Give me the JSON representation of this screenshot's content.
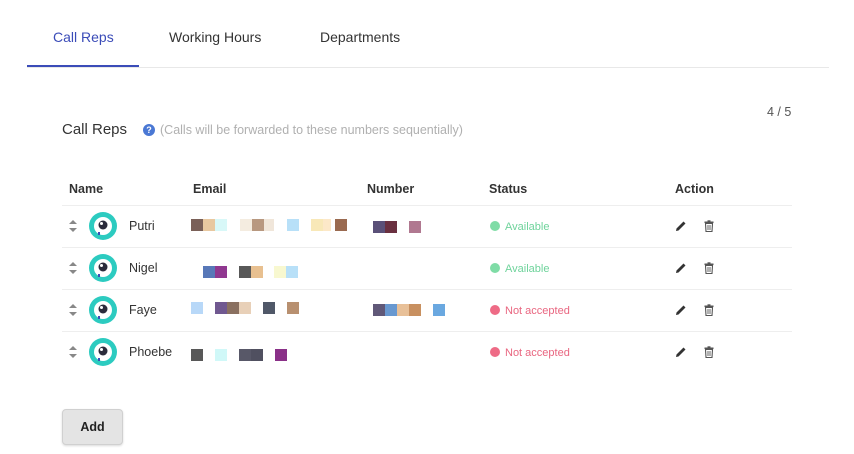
{
  "tabs": [
    {
      "label": "Call Reps",
      "active": true
    },
    {
      "label": "Working Hours",
      "active": false
    },
    {
      "label": "Departments",
      "active": false
    }
  ],
  "section": {
    "title": "Call Reps",
    "help_icon": "question-circle-icon",
    "hint": "(Calls will be forwarded to these numbers sequentially)",
    "counter": "4 / 5"
  },
  "columns": {
    "name": "Name",
    "email": "Email",
    "number": "Number",
    "status": "Status",
    "action": "Action"
  },
  "reps": [
    {
      "name": "Putri",
      "status": "Available"
    },
    {
      "name": "Nigel",
      "status": "Available"
    },
    {
      "name": "Faye",
      "status": "Not accepted"
    },
    {
      "name": "Phoebe",
      "status": "Not accepted"
    }
  ],
  "icons": {
    "drag": "drag-handle-icon",
    "edit": "pencil-icon",
    "delete": "trash-icon"
  },
  "colors": {
    "accent": "#3b4cb8",
    "available": "#7fdca6",
    "not_accepted": "#ee6b86",
    "avatar": "#2ccbc0"
  },
  "add_button": "Add"
}
